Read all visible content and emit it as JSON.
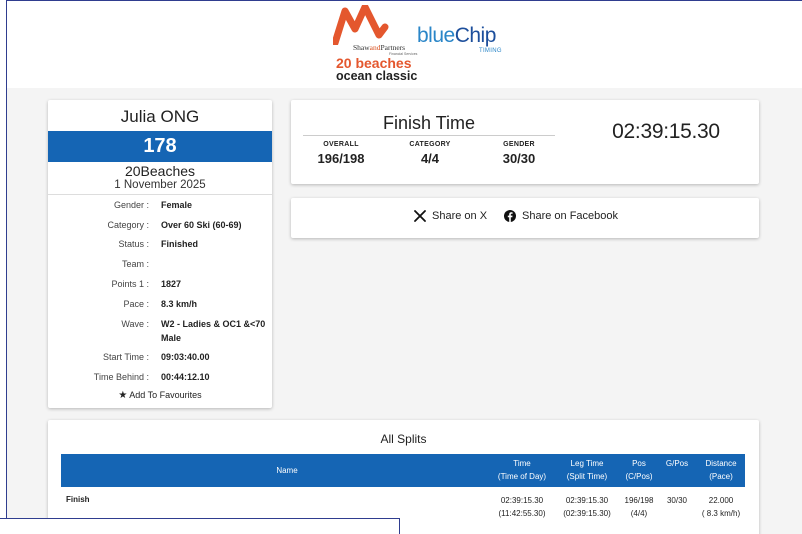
{
  "header": {
    "sponsor_name_pre": "Shaw",
    "sponsor_name_and": "and",
    "sponsor_name_post": "Partners",
    "sponsor_sub": "Financial Services",
    "timing_brand_blue": "blue",
    "timing_brand_chip": "Chip",
    "timing_sub": "TIMING",
    "event_logo_line1": "20 beaches",
    "event_logo_line2": "ocean classic"
  },
  "athlete": {
    "name": "Julia ONG",
    "bib": "178",
    "event": "20Beaches",
    "date": "1 November 2025",
    "details": [
      {
        "label": "Gender :",
        "value": "Female"
      },
      {
        "label": "Category :",
        "value": "Over 60 Ski (60-69)"
      },
      {
        "label": "Status :",
        "value": "Finished"
      },
      {
        "label": "Team :",
        "value": ""
      },
      {
        "label": "Points 1 :",
        "value": "1827"
      },
      {
        "label": "Pace :",
        "value": "8.3 km/h"
      },
      {
        "label": "Wave :",
        "value": "W2 - Ladies & OC1 &<70",
        "value2": "Male"
      },
      {
        "label": "Start Time :",
        "value": "09:03:40.00"
      },
      {
        "label": "Time Behind :",
        "value": "00:44:12.10"
      }
    ],
    "favourites_label": "Add To Favourites"
  },
  "finish": {
    "title": "Finish Time",
    "time": "02:39:15.30",
    "stats": [
      {
        "label": "OVERALL",
        "value": "196/198"
      },
      {
        "label": "CATEGORY",
        "value": "4/4"
      },
      {
        "label": "GENDER",
        "value": "30/30"
      }
    ]
  },
  "share": {
    "x_label": "Share on X",
    "facebook_label": "Share on Facebook"
  },
  "splits": {
    "title": "All Splits",
    "headers": {
      "name": "Name",
      "time_1": "Time",
      "time_2": "(Time of Day)",
      "leg_1": "Leg Time",
      "leg_2": "(Split Time)",
      "pos_1": "Pos",
      "pos_2": "(C/Pos)",
      "gpos_1": "G/Pos",
      "dist_1": "Distance",
      "dist_2": "(Pace)"
    },
    "rows": [
      {
        "name": "Finish",
        "time": "02:39:15.30",
        "time_of_day": "(11:42:55.30)",
        "leg": "02:39:15.30",
        "split": "(02:39:15.30)",
        "pos": "196/198",
        "cpos": "(4/4)",
        "gpos": "30/30",
        "distance": "22.000",
        "pace": "( 8.3 km/h)"
      }
    ]
  },
  "colors": {
    "accent_blue": "#1565b4",
    "logo_orange": "#e4572e",
    "frame_border": "#2f3d8f"
  }
}
